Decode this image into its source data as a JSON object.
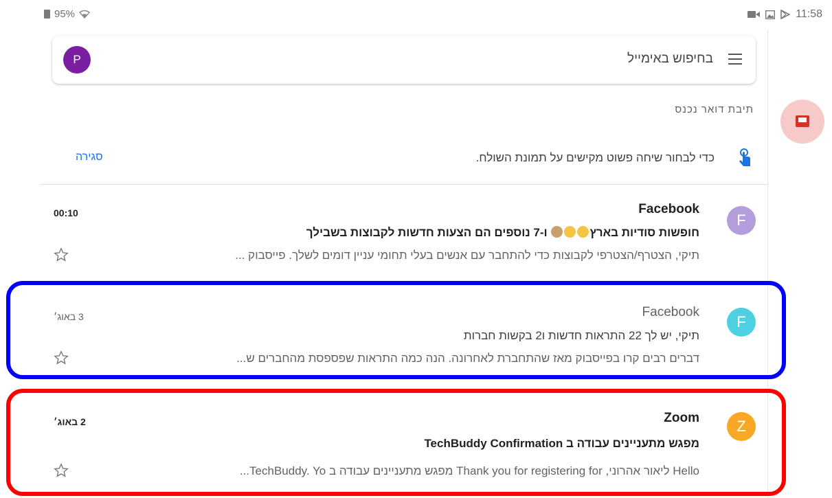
{
  "status": {
    "battery": "95%",
    "time": "11:58"
  },
  "search": {
    "placeholder": "בחיפוש באימייל",
    "avatar_letter": "P"
  },
  "folder_label": "תיבת דואר נכנס",
  "tip": {
    "text": "כדי לבחור שיחה פשוט מקישים על תמונת השולח.",
    "close_label": "סגירה"
  },
  "emails": [
    {
      "avatar_letter": "F",
      "avatar_color": "#b39ddb",
      "sender": "Facebook",
      "time": "00:10",
      "subject_part1": "חופשות סודיות בארץ",
      "subject_part2": "ו-7 נוספים הם הצעות חדשות לקבוצות בשבילך",
      "snippet": "תיקי, הצטרף/הצטרפי לקבוצות כדי להתחבר עם אנשים בעלי תחומי עניין דומים לשלך. פייסבוק ...",
      "unread": true
    },
    {
      "avatar_letter": "F",
      "avatar_color": "#4dd0e1",
      "sender": "Facebook",
      "time": "3 באוג׳",
      "subject": "תיקי, יש לך 22 התראות חדשות ו2 בקשות חברות",
      "snippet": "דברים רבים קרו בפייסבוק מאז שהתחברת לאחרונה. הנה כמה התראות שפספסת מהחברים ש...",
      "unread": false
    },
    {
      "avatar_letter": "Z",
      "avatar_color": "#f9a825",
      "sender": "Zoom",
      "time": "2 באוג׳",
      "subject": "מפגש מתעניינים עבודה ב TechBuddy Confirmation",
      "snippet": "Hello ליאור אהרוני, Thank you for registering for מפגש מתעניינים עבודה ב TechBuddy. Yo...",
      "unread": true
    }
  ],
  "colors": {
    "highlight_blue": "#0000ff",
    "highlight_red": "#ff0000",
    "accent_link": "#1a73e8",
    "fab_bg": "#f7c9c9",
    "fab_icon": "#d93025"
  },
  "icons": [
    "battery-icon",
    "wifi-icon",
    "video-icon",
    "image-icon",
    "play-store-icon",
    "menu-icon",
    "touch-icon",
    "star-icon",
    "inbox-icon"
  ]
}
